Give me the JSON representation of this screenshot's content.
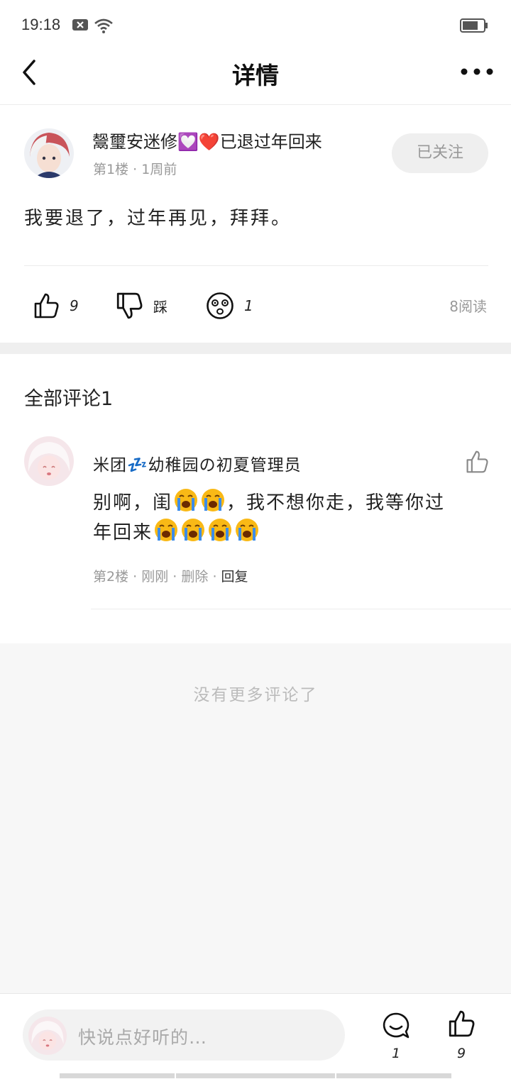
{
  "status_bar": {
    "time": "19:18"
  },
  "header": {
    "title": "详情"
  },
  "post": {
    "author": "鬶璽安迷修💟❤️已退过年回来",
    "floor": "第1楼",
    "time": "1周前",
    "follow_label": "已关注",
    "content": "我要退了，过年再见，拜拜。",
    "likes": "9",
    "dislike_label": "踩",
    "reactions": "1",
    "reads": "8阅读"
  },
  "comments_section": {
    "title": "全部评论1",
    "items": [
      {
        "author": "米团💤幼稚园の初夏管理员",
        "text_line1": "别啊，闺",
        "text_line1b": "，我不想你走，我等你过",
        "text_line2": "年回来",
        "floor": "第2楼",
        "time": "刚刚",
        "delete_label": "删除",
        "reply_label": "回复"
      }
    ],
    "no_more": "没有更多评论了"
  },
  "bottom_bar": {
    "input_placeholder": "快说点好听的…",
    "comment_count": "1",
    "like_count": "9"
  },
  "colors": {
    "follow_bg": "#efefef",
    "meta_text": "#999999",
    "divider": "#efefef"
  }
}
